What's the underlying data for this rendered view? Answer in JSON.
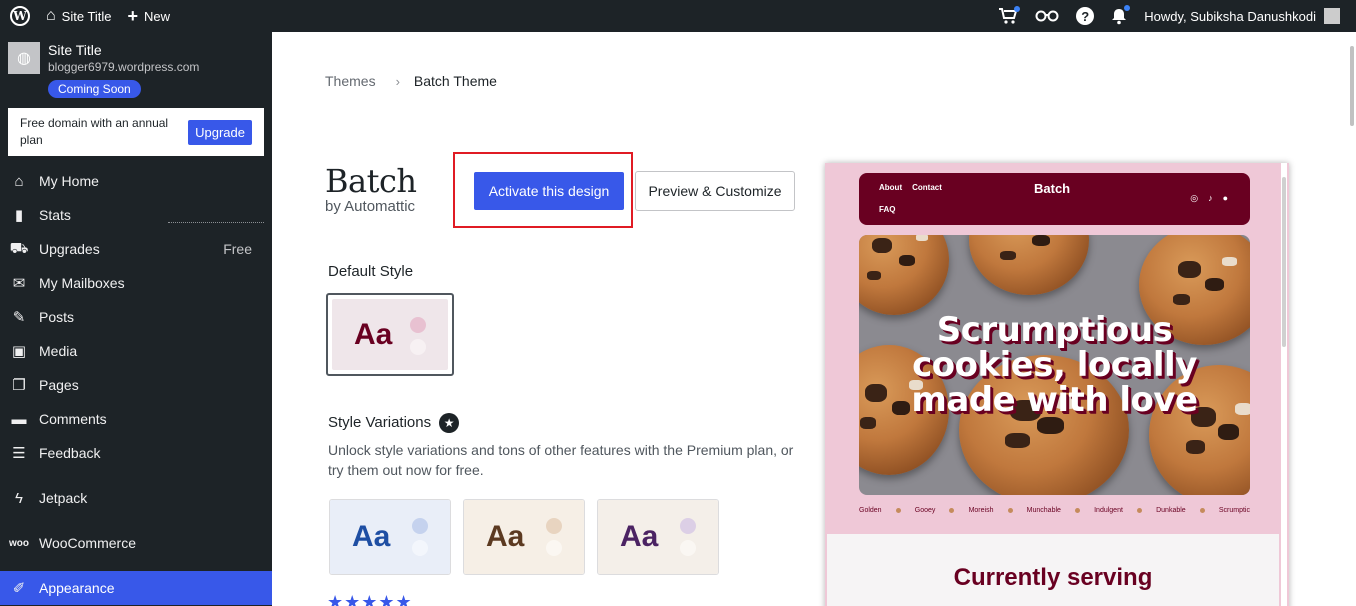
{
  "adminbar": {
    "site_title": "Site Title",
    "new_label": "New",
    "greeting": "Howdy, Subiksha Danushkodi"
  },
  "sidebar": {
    "site_title": "Site Title",
    "site_url": "blogger6979.wordpress.com",
    "badge": "Coming Soon",
    "promo_text": "Free domain with an annual plan",
    "promo_button": "Upgrade",
    "items": [
      {
        "label": "My Home",
        "icon": "home-icon"
      },
      {
        "label": "Stats",
        "icon": "stats-icon"
      },
      {
        "label": "Upgrades",
        "icon": "cart-icon",
        "extra": "Free"
      },
      {
        "label": "My Mailboxes",
        "icon": "mail-icon"
      },
      {
        "label": "Posts",
        "icon": "pin-icon"
      },
      {
        "label": "Media",
        "icon": "media-icon"
      },
      {
        "label": "Pages",
        "icon": "pages-icon"
      },
      {
        "label": "Comments",
        "icon": "comment-icon"
      },
      {
        "label": "Feedback",
        "icon": "feedback-icon"
      },
      {
        "label": "Jetpack",
        "icon": "jetpack-icon"
      },
      {
        "label": "WooCommerce",
        "icon": "woo-icon"
      },
      {
        "label": "Appearance",
        "icon": "brush-icon"
      }
    ]
  },
  "breadcrumb": {
    "parent": "Themes",
    "current": "Batch Theme"
  },
  "theme": {
    "name": "Batch",
    "author": "by Automattic",
    "activate_label": "Activate this design",
    "preview_label": "Preview & Customize"
  },
  "styles": {
    "default_heading": "Default Style",
    "variations_heading": "Style Variations",
    "variations_desc": "Unlock style variations and tons of other features with the Premium plan, or try them out now for free.",
    "swatch_text": "Aa",
    "default_colors": {
      "bg": "#efe6ea",
      "text": "#690021",
      "c1": "#e8c1d1",
      "c2": "#f7f1f3"
    },
    "variations": [
      {
        "bg": "#e9eef8",
        "text": "#1e4ea3",
        "c1": "#c5d2ee",
        "c2": "#f3f6fc"
      },
      {
        "bg": "#f6efe6",
        "text": "#5c3a21",
        "c1": "#e8d4c0",
        "c2": "#fbf7f2"
      },
      {
        "bg": "#f4efe9",
        "text": "#4b2363",
        "c1": "#dccfe6",
        "c2": "#faf7f3"
      }
    ],
    "rating": "★★★★★"
  },
  "preview": {
    "nav_links": [
      "About",
      "Contact"
    ],
    "nav_faq": "FAQ",
    "brand": "Batch",
    "headline": "Scrumptious cookies, locally made with love",
    "tags": [
      "Golden",
      "Gooey",
      "Moreish",
      "Munchable",
      "Indulgent",
      "Dunkable",
      "Scrumptic"
    ],
    "section_title": "Currently serving"
  }
}
